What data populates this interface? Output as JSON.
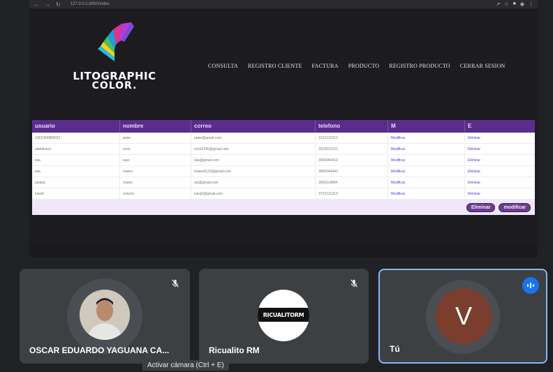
{
  "browser": {
    "url": "127.0.0.1:8000/index"
  },
  "site": {
    "logo": {
      "line1": "LITOGRAPHIC",
      "line2": "COLOR."
    },
    "menu": [
      "CONSULTA",
      "REGISTRO CLIENTE",
      "FACTURA",
      "PRODUCTO",
      "REGISTRO PRODUCTO",
      "CERRAR SESION"
    ],
    "table": {
      "headers": [
        "usuario",
        "nombre",
        "correo",
        "telefono",
        "M",
        "E"
      ],
      "rows": [
        [
          "1001054889023",
          "pepe",
          "pepe@gmail.com",
          "3121212312",
          "Modificar",
          "Eliminar"
        ],
        [
          "abdelkarst",
          "erick",
          "erick3345@gmail.com",
          "3013012121",
          "Modificar",
          "Eliminar"
        ],
        [
          "laia",
          "laan",
          "laia@gmail.com",
          "3000044412",
          "Modificar",
          "Eliminar"
        ],
        [
          "laia",
          "mateo",
          "mateo4123@gmail.com",
          "3000044443",
          "Modificar",
          "Eliminar"
        ],
        [
          "akabia",
          "mateo",
          "ast@gmail.com",
          "3000119894",
          "Modificar",
          "Eliminar"
        ],
        [
          "luisa5",
          "victoria",
          "luisa5@gmail.com",
          "3722121313",
          "Modificar",
          "Eliminar"
        ]
      ],
      "actions": {
        "delete": "Eliminar",
        "modify": "modificar"
      }
    }
  },
  "participants": [
    {
      "name": "OSCAR EDUARDO YAGUANA CA...",
      "muted": true
    },
    {
      "name": "Ricualito RM",
      "avatar_text": "RICUALITORM",
      "muted": true
    },
    {
      "name": "Tú",
      "initial": "V",
      "speaking": true
    }
  ],
  "tooltip": "Activar cámara (Ctrl + E)",
  "colors": {
    "header_purple": "#5a2d8c",
    "speaking_blue": "#1a73e8",
    "self_avatar": "#7b3d2e"
  }
}
